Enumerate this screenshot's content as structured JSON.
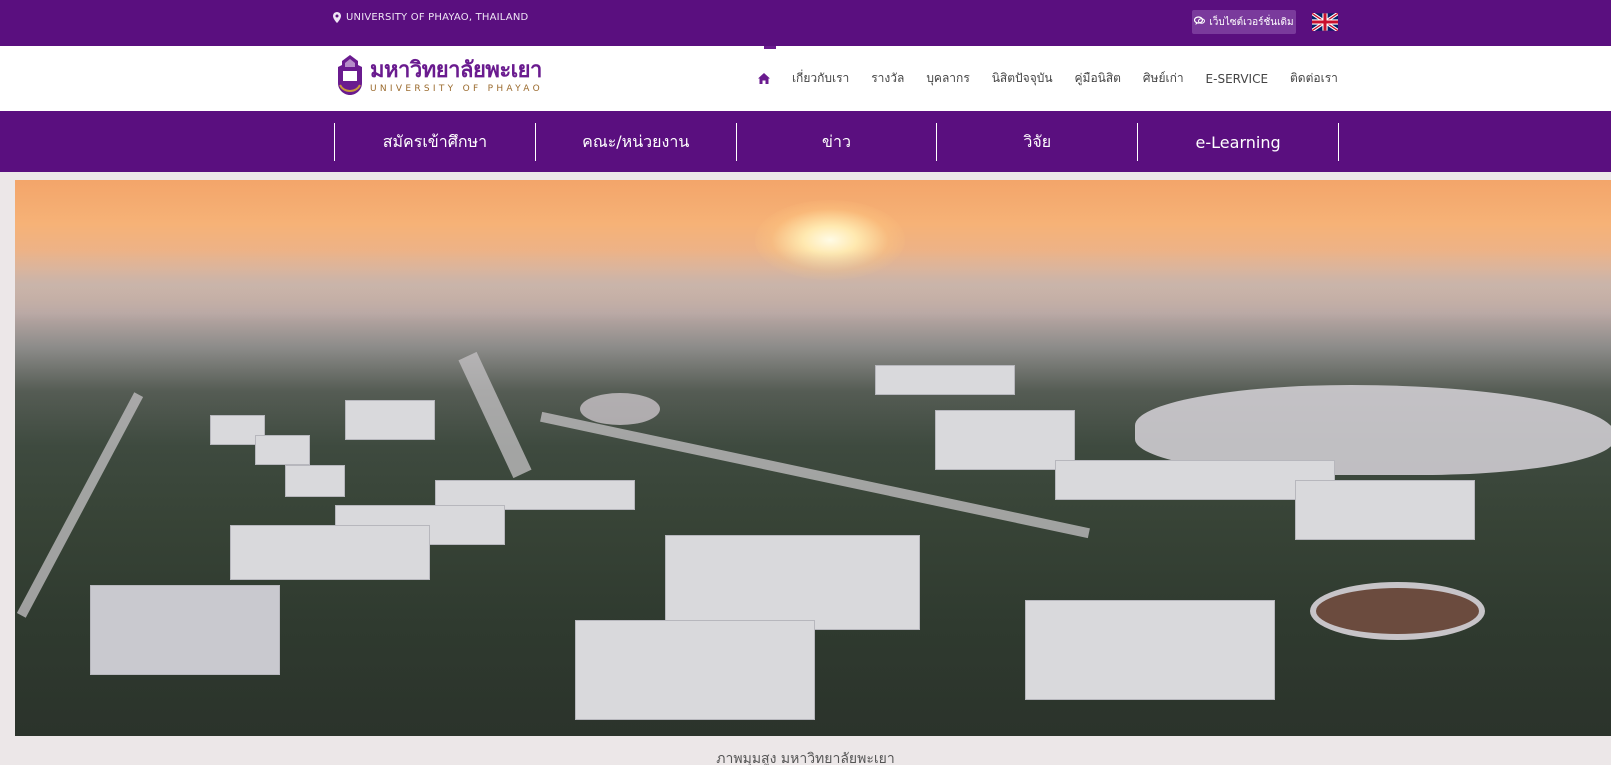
{
  "topbar": {
    "location_text": "UNIVERSITY OF PHAYAO, THAILAND",
    "location_icon": "map-pin-icon",
    "old_site_label": "เว็บไซต์เวอร์ชั่นเดิม",
    "old_site_icon": "chat-icon",
    "language_icon": "uk-flag-icon",
    "background_color": "#5a0f7f"
  },
  "header": {
    "logo": {
      "thai": "มหาวิทยาลัยพะเยา",
      "english": "UNIVERSITY OF PHAYAO"
    },
    "nav": {
      "home_icon": "home-icon",
      "items": [
        {
          "label": "เกี่ยวกับเรา"
        },
        {
          "label": "รางวัล"
        },
        {
          "label": "บุคลากร"
        },
        {
          "label": "นิสิตปัจจุบัน"
        },
        {
          "label": "คู่มือนิสิต"
        },
        {
          "label": "ศิษย์เก่า"
        },
        {
          "label": "E-SERVICE"
        },
        {
          "label": "ติดต่อเรา"
        }
      ]
    }
  },
  "main_menu": {
    "items": [
      {
        "label": "สมัครเข้าศึกษา"
      },
      {
        "label": "คณะ/หน่วยงาน"
      },
      {
        "label": "ข่าว"
      },
      {
        "label": "วิจัย"
      },
      {
        "label": "e-Learning"
      }
    ]
  },
  "hero": {
    "caption": "ภาพมุมสูง มหาวิทยาลัยพะเยา"
  },
  "colors": {
    "brand_purple": "#5a0f7f",
    "accent_gold": "#9b6b2e"
  }
}
